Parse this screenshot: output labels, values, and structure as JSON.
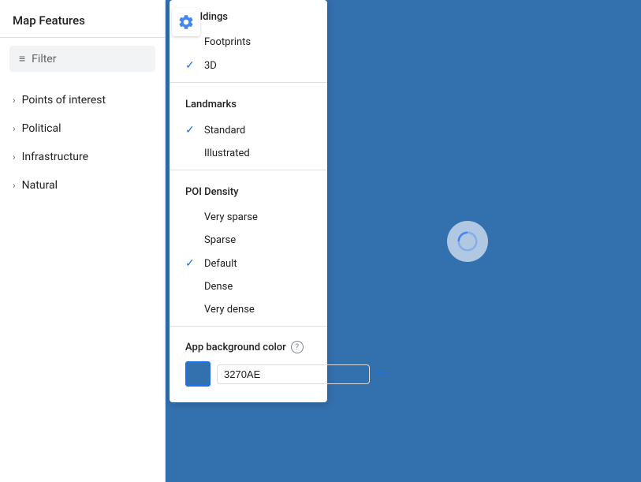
{
  "sidebar": {
    "title": "Map Features",
    "filter": {
      "placeholder": "Filter",
      "icon": "≡"
    },
    "nav_items": [
      {
        "label": "Points of interest"
      },
      {
        "label": "Political"
      },
      {
        "label": "Infrastructure"
      },
      {
        "label": "Natural"
      }
    ]
  },
  "gear_icon": "gear",
  "dropdown": {
    "sections": [
      {
        "label": "Buildings",
        "items": [
          {
            "label": "Footprints",
            "checked": false
          },
          {
            "label": "3D",
            "checked": true
          }
        ]
      },
      {
        "label": "Landmarks",
        "items": [
          {
            "label": "Standard",
            "checked": true
          },
          {
            "label": "Illustrated",
            "checked": false
          }
        ]
      },
      {
        "label": "POI Density",
        "items": [
          {
            "label": "Very sparse",
            "checked": false
          },
          {
            "label": "Sparse",
            "checked": false
          },
          {
            "label": "Default",
            "checked": true
          },
          {
            "label": "Dense",
            "checked": false
          },
          {
            "label": "Very dense",
            "checked": false
          }
        ]
      }
    ],
    "bg_color": {
      "label": "App background color",
      "help_icon": "?",
      "value": "3270AE",
      "clear_label": "—"
    }
  },
  "map": {
    "loading_icon": "C",
    "bg_color": "#3270AE"
  }
}
